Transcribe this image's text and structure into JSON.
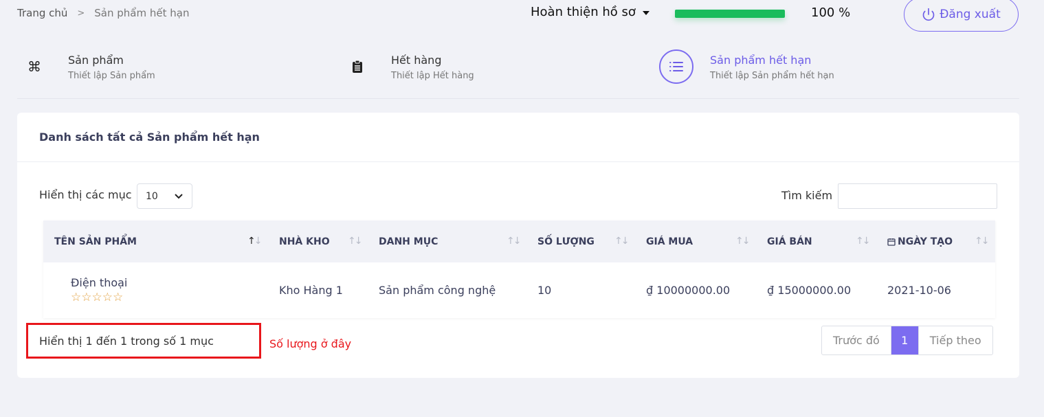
{
  "breadcrumb": {
    "home": "Trang chủ",
    "separator": ">",
    "current": "Sản phẩm hết hạn"
  },
  "header": {
    "profile_label": "Hoàn thiện hồ sơ",
    "progress_percent": 100,
    "progress_text": "100 %",
    "logout_label": "Đăng xuất"
  },
  "steps": [
    {
      "title": "Sản phẩm",
      "subtitle": "Thiết lập Sản phẩm",
      "icon": "command-icon"
    },
    {
      "title": "Hết hàng",
      "subtitle": "Thiết lập Hết hàng",
      "icon": "clipboard-icon"
    },
    {
      "title": "Sản phẩm hết hạn",
      "subtitle": "Thiết lập Sản phẩm hết hạn",
      "icon": "list-icon"
    }
  ],
  "card": {
    "title": "Danh sách tất cả Sản phẩm hết hạn",
    "length_label": "Hiển thị các mục",
    "length_value": "10",
    "search_label": "Tìm kiếm",
    "search_value": ""
  },
  "table": {
    "columns": [
      "TÊN SẢN PHẨM",
      "NHÀ KHO",
      "DANH MỤC",
      "SỐ LƯỢNG",
      "GIÁ MUA",
      "GIÁ BÁN",
      "NGÀY TẠO"
    ],
    "rows": [
      {
        "name": "Điện thoại",
        "rating": 0,
        "warehouse": "Kho Hàng 1",
        "category": "Sản phẩm công nghệ",
        "quantity": "10",
        "buy_price": "₫ 10000000.00",
        "sell_price": "₫ 15000000.00",
        "created": "2021-10-06"
      }
    ]
  },
  "footer": {
    "info_text": "Hiển thị 1 đến 1 trong số 1 mục",
    "annotation": "Số lượng ở đây",
    "prev_label": "Trước đó",
    "page": "1",
    "next_label": "Tiếp theo"
  },
  "colors": {
    "accent": "#7c6cf0",
    "progress": "#1abc5c",
    "annotation": "#e8161b",
    "star": "#e2a03f"
  }
}
